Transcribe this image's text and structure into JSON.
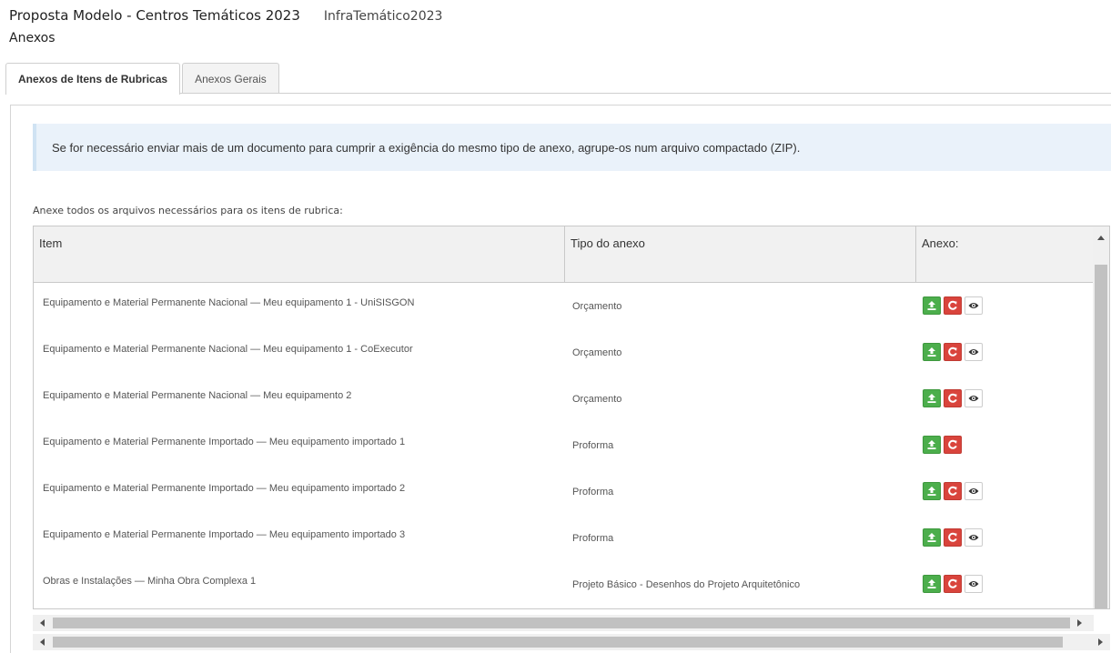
{
  "header": {
    "proposal_title": "Proposta Modelo - Centros Temáticos 2023",
    "proposal_code": "InfraTemático2023",
    "section_title": "Anexos"
  },
  "tabs": [
    {
      "label": "Anexos de Itens de Rubricas",
      "active": true
    },
    {
      "label": "Anexos Gerais",
      "active": false
    }
  ],
  "alert": {
    "text": "Se for necessário enviar mais de um documento para cumprir a exigência do mesmo tipo de anexo, agrupe-os num arquivo compactado (ZIP)."
  },
  "instruction": "Anexe todos os arquivos necessários para os itens de rubrica:",
  "table": {
    "headers": [
      "Item",
      "Tipo do anexo",
      "Anexo:"
    ],
    "rows": [
      {
        "item": "Equipamento e Material Permanente Nacional — Meu equipamento 1 - UniSISGON",
        "tipo": "Orçamento",
        "has_view": true
      },
      {
        "item": "Equipamento e Material Permanente Nacional — Meu equipamento 1 - CoExecutor",
        "tipo": "Orçamento",
        "has_view": true
      },
      {
        "item": "Equipamento e Material Permanente Nacional — Meu equipamento 2",
        "tipo": "Orçamento",
        "has_view": true
      },
      {
        "item": "Equipamento e Material Permanente Importado — Meu equipamento importado 1",
        "tipo": "Proforma",
        "has_view": false
      },
      {
        "item": "Equipamento e Material Permanente Importado — Meu equipamento importado 2",
        "tipo": "Proforma",
        "has_view": true
      },
      {
        "item": "Equipamento e Material Permanente Importado — Meu equipamento importado 3",
        "tipo": "Proforma",
        "has_view": true
      },
      {
        "item": "Obras e Instalações — Minha Obra Complexa 1",
        "tipo": "Projeto Básico - Desenhos do Projeto Arquitetônico",
        "has_view": true
      }
    ]
  },
  "icons": {
    "upload": "upload-icon",
    "replace": "refresh-icon",
    "view": "eye-icon"
  },
  "colors": {
    "upload_button": "#4cae4c",
    "replace_button": "#d9443c",
    "alert_background": "#eaf2fa"
  }
}
